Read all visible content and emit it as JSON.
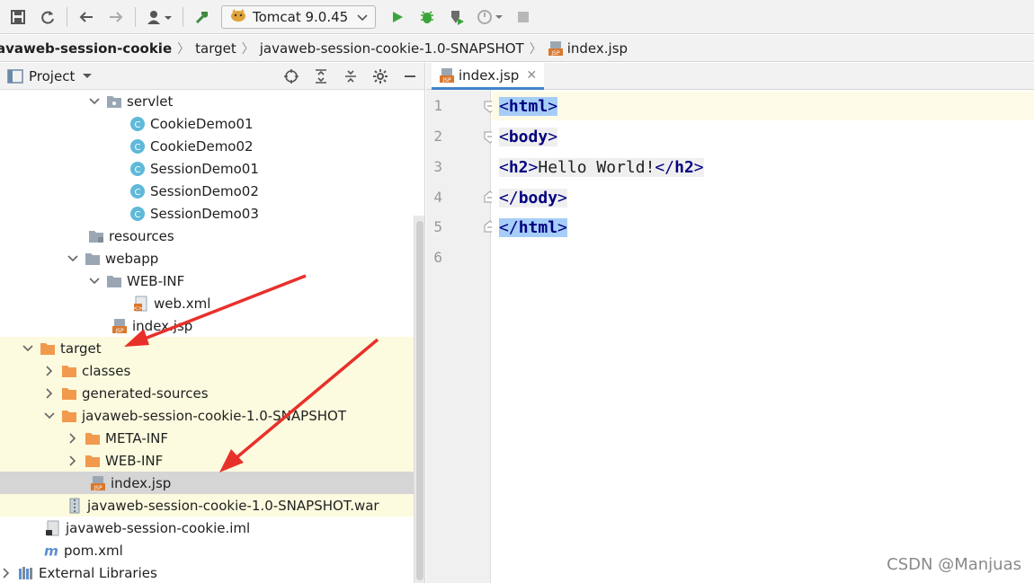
{
  "toolbar": {
    "run_config_label": "Tomcat 9.0.45",
    "icons": [
      "save-icon",
      "sync-icon",
      "back-icon",
      "forward-icon",
      "user-icon",
      "build-icon",
      "tomcat-icon",
      "run-icon",
      "debug-icon",
      "coverage-icon",
      "profile-icon",
      "stop-icon"
    ]
  },
  "breadcrumb": {
    "items": [
      "avaweb-session-cookie",
      "target",
      "javaweb-session-cookie-1.0-SNAPSHOT",
      "index.jsp"
    ]
  },
  "project_panel": {
    "title": "Project",
    "tree": [
      {
        "label": "servlet",
        "icon": "package"
      },
      {
        "label": "CookieDemo01",
        "icon": "class"
      },
      {
        "label": "CookieDemo02",
        "icon": "class"
      },
      {
        "label": "SessionDemo01",
        "icon": "class"
      },
      {
        "label": "SessionDemo02",
        "icon": "class"
      },
      {
        "label": "SessionDemo03",
        "icon": "class"
      },
      {
        "label": "resources",
        "icon": "res-folder"
      },
      {
        "label": "webapp",
        "icon": "folder"
      },
      {
        "label": "WEB-INF",
        "icon": "folder"
      },
      {
        "label": "web.xml",
        "icon": "xml"
      },
      {
        "label": "index.jsp",
        "icon": "jsp"
      },
      {
        "label": "target",
        "icon": "orange-folder"
      },
      {
        "label": "classes",
        "icon": "orange-folder"
      },
      {
        "label": "generated-sources",
        "icon": "orange-folder"
      },
      {
        "label": "javaweb-session-cookie-1.0-SNAPSHOT",
        "icon": "orange-folder"
      },
      {
        "label": "META-INF",
        "icon": "orange-folder"
      },
      {
        "label": "WEB-INF",
        "icon": "orange-folder"
      },
      {
        "label": "index.jsp",
        "icon": "jsp"
      },
      {
        "label": "javaweb-session-cookie-1.0-SNAPSHOT.war",
        "icon": "war"
      },
      {
        "label": "javaweb-session-cookie.iml",
        "icon": "iml"
      },
      {
        "label": "pom.xml",
        "icon": "maven"
      },
      {
        "label": "External Libraries",
        "icon": "libraries"
      }
    ]
  },
  "editor": {
    "tab_label": "index.jsp",
    "line_numbers": [
      "1",
      "2",
      "3",
      "4",
      "5",
      "6"
    ],
    "lines": {
      "l1_open": "<",
      "l1_name": "html",
      "l1_close": ">",
      "l2_open": "<",
      "l2_name": "body",
      "l2_close": ">",
      "l3_open": "<",
      "l3_name": "h2",
      "l3_close": ">",
      "l3_text": "Hello World!",
      "l3_end_open": "</",
      "l3_end_name": "h2",
      "l3_end_close": ">",
      "l4_open": "</",
      "l4_name": "body",
      "l4_close": ">",
      "l5_open": "</",
      "l5_name": "html",
      "l5_close": ">"
    }
  },
  "watermark": "CSDN @Manjuas",
  "colors": {
    "highlight_row": "#fcfbdf",
    "selected_row": "#d5d5d5",
    "tag_color": "#000080",
    "tag_match_bg": "#a6cdf7",
    "arrow_red": "#e8302b"
  }
}
